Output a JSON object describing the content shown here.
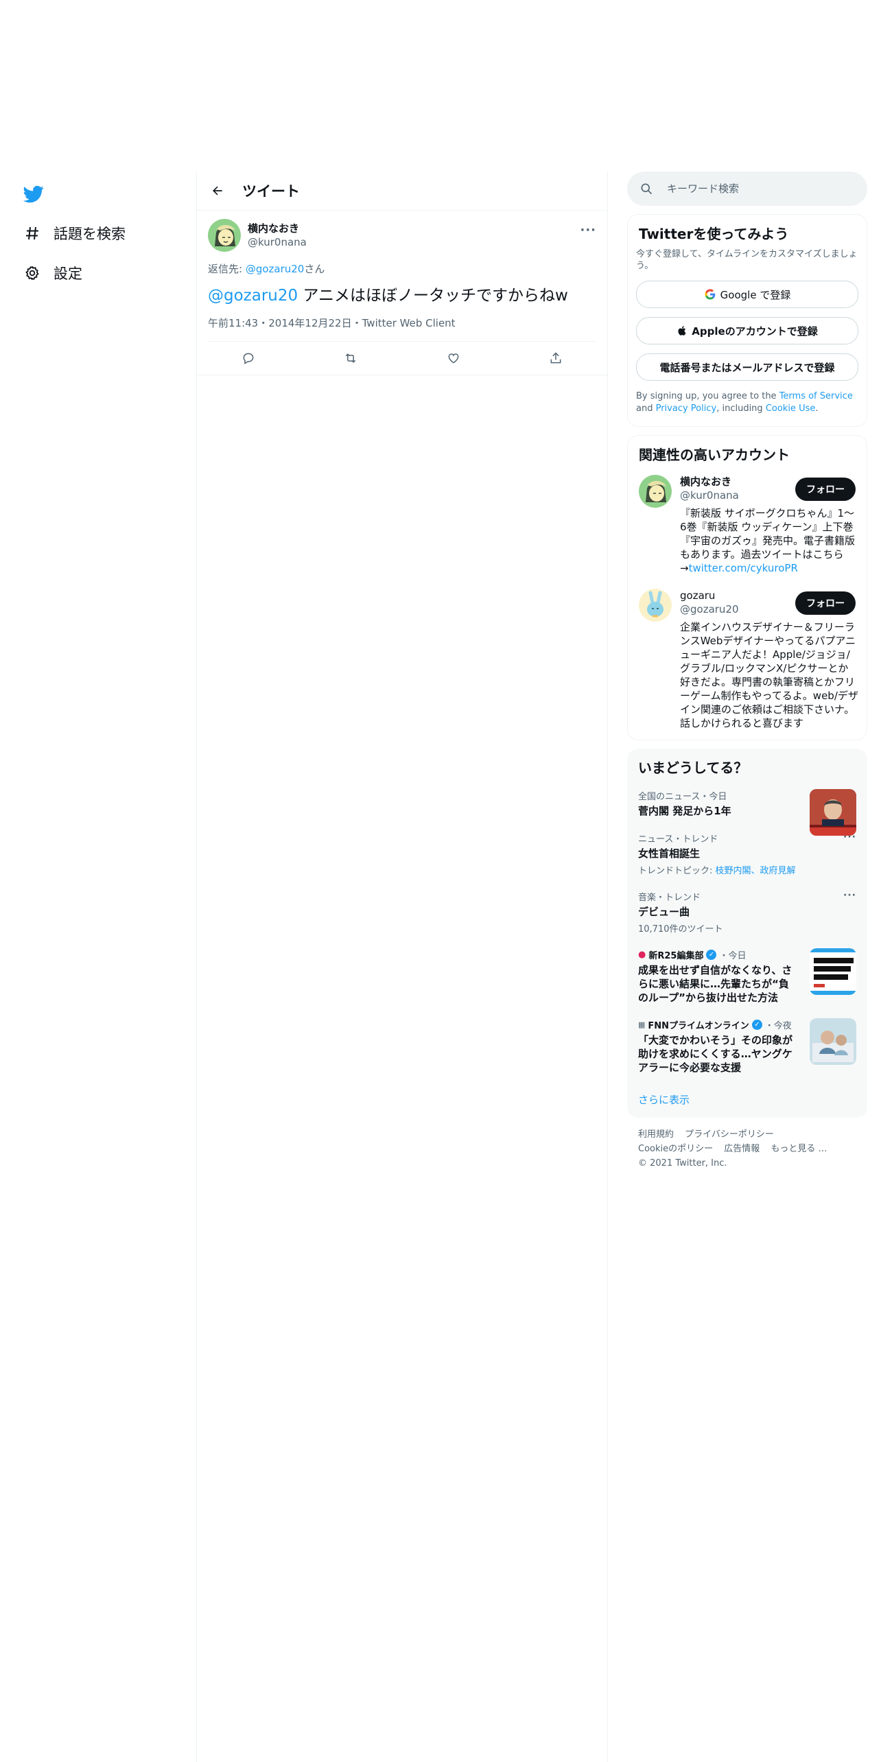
{
  "nav": {
    "items": [
      {
        "label": "話題を検索",
        "icon": "hashtag-icon"
      },
      {
        "label": "設定",
        "icon": "gear-icon"
      }
    ]
  },
  "header": {
    "title": "ツイート"
  },
  "tweet": {
    "author_name": "横内なおき",
    "author_handle": "@kur0nana",
    "reply_to_prefix": "返信先: ",
    "reply_to_handle": "@gozaru20",
    "reply_to_suffix": "さん",
    "mention": "@gozaru20",
    "text": " アニメはほぼノータッチですからねw",
    "time": "午前11:43",
    "date": "2014年12月22日",
    "source": "Twitter Web Client",
    "separator": "・"
  },
  "search": {
    "placeholder": "キーワード検索"
  },
  "signup": {
    "title": "Twitterを使ってみよう",
    "subtitle": "今すぐ登録して、タイムラインをカスタマイズしましょう。",
    "google_label": "Google で登録",
    "apple_label": "Appleのアカウントで登録",
    "phone_label": "電話番号またはメールアドレスで登録",
    "legal_1": "By signing up, you agree to the ",
    "terms": "Terms of Service",
    "legal_2": " and ",
    "privacy": "Privacy Policy",
    "legal_3": ", including ",
    "cookie": "Cookie Use",
    "legal_4": "."
  },
  "who": {
    "title": "関連性の高いアカウント",
    "accounts": [
      {
        "name": "横内なおき",
        "handle": "@kur0nana",
        "bio": "『新装版 サイボーグクロちゃん』1～6巻『新装版 ウッディケーン』上下巻『宇宙のガズゥ』発売中。電子書籍版もあります。過去ツイートはこちら→",
        "bio_link": "twitter.com/cykuroPR",
        "follow_label": "フォロー"
      },
      {
        "name": "gozaru",
        "handle": "@gozaru20",
        "bio": "企業インハウスデザイナー＆フリーランスWebデザイナーやってるパプアニューギニア人だよ！Apple/ジョジョ/グラブル/ロックマンX/ピクサーとか好きだよ。専門書の執筆寄稿とかフリーゲーム制作もやってるよ。web/デザイン関連のご依頼はご相談下さいナ。話しかけられると喜びます",
        "follow_label": "フォロー"
      }
    ]
  },
  "trends": {
    "title": "いまどうしてる？",
    "items": [
      {
        "context": "全国のニュース・今日",
        "title": "菅内閣 発足から1年"
      },
      {
        "context": "ニュース・トレンド",
        "title": "女性首相誕生",
        "sub_prefix": "トレンドトピック: ",
        "sub_links": "枝野内閣、政府見解"
      },
      {
        "context": "音楽・トレンド",
        "title": "デビュー曲",
        "sub": "10,710件のツイート"
      },
      {
        "source": "新R25編集部",
        "time": "・今日",
        "title": "成果を出せず自信がなくなり、さらに悪い結果に…先輩たちが“負のループ”から抜け出せた方法"
      },
      {
        "source": "FNNプライムオンライン",
        "time": "・今夜",
        "title": "「大変でかわいそう」その印象が助けを求めにくくする…ヤングケアラーに今必要な支援"
      }
    ],
    "show_more": "さらに表示"
  },
  "footer": {
    "links_row1": [
      "利用規約",
      "プライバシーポリシー"
    ],
    "links_row2": [
      "Cookieのポリシー",
      "広告情報",
      "もっと見る …"
    ],
    "copyright": "© 2021 Twitter, Inc."
  },
  "colors": {
    "accent": "#1d9bf0",
    "text": "#0f1419",
    "muted": "#536471",
    "border": "#eff3f4"
  }
}
